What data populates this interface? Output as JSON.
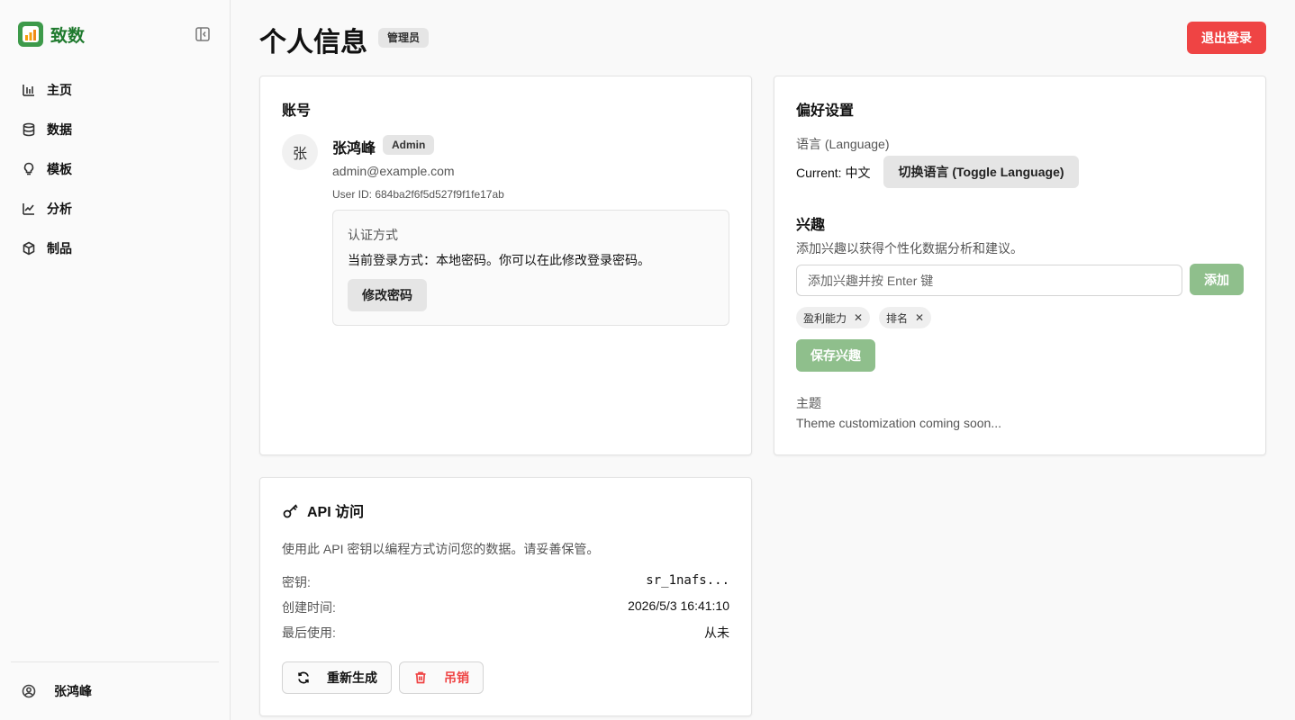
{
  "app": {
    "name": "致数"
  },
  "sidebar": {
    "items": [
      {
        "label": "主页",
        "icon": "bar-chart-icon"
      },
      {
        "label": "数据",
        "icon": "database-icon"
      },
      {
        "label": "模板",
        "icon": "lightbulb-icon"
      },
      {
        "label": "分析",
        "icon": "line-chart-icon"
      },
      {
        "label": "制品",
        "icon": "box-icon"
      }
    ],
    "user": "张鸿峰"
  },
  "header": {
    "title": "个人信息",
    "role": "管理员",
    "logout": "退出登录"
  },
  "account": {
    "title": "账号",
    "avatar": "张",
    "name": "张鸿峰",
    "badge": "Admin",
    "email": "admin@example.com",
    "user_id": "User ID: 684ba2f6f5d527f9f1fe17ab",
    "auth_title": "认证方式",
    "auth_desc": "当前登录方式：本地密码。你可以在此修改登录密码。",
    "change_password": "修改密码"
  },
  "preferences": {
    "title": "偏好设置",
    "language_label": "语言 (Language)",
    "current_language": "Current: 中文",
    "toggle_language": "切换语言 (Toggle Language)",
    "interests_title": "兴趣",
    "interests_desc": "添加兴趣以获得个性化数据分析和建议。",
    "interest_placeholder": "添加兴趣并按 Enter 键",
    "add": "添加",
    "tags": [
      "盈利能力",
      "排名"
    ],
    "save_interests": "保存兴趣",
    "theme_label": "主题",
    "theme_note": "Theme customization coming soon..."
  },
  "api": {
    "title": "API 访问",
    "desc": "使用此 API 密钥以编程方式访问您的数据。请妥善保管。",
    "rows": [
      {
        "label": "密钥:",
        "value": "sr_1nafs..."
      },
      {
        "label": "创建时间:",
        "value": "2026/5/3 16:41:10"
      },
      {
        "label": "最后使用:",
        "value": "从未"
      }
    ],
    "regenerate": "重新生成",
    "revoke": "吊销"
  },
  "colors": {
    "brand": "#1f7a2e",
    "danger": "#ef4444",
    "accent_muted": "#8fbf8c"
  }
}
